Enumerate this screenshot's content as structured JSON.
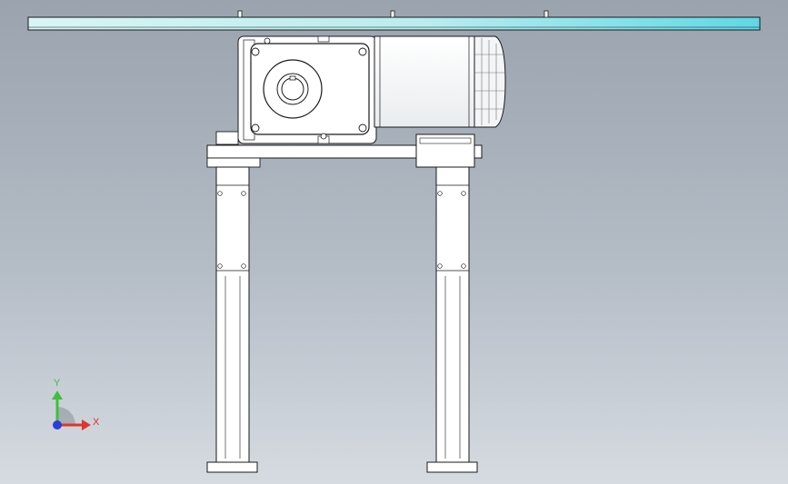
{
  "viewport": {
    "background_top": "#9aa3ae",
    "background_bottom": "#d6dbe1"
  },
  "model": {
    "plate_color_left": "#c8f2ef",
    "plate_color_right": "#5fd8e6",
    "part_fill": "#ffffff",
    "line_color": "#1a1a1a"
  },
  "triad": {
    "x_label": "X",
    "y_label": "Y",
    "x_color": "#e0342c",
    "y_color": "#3fbf3f",
    "z_color": "#2a3fd6"
  }
}
